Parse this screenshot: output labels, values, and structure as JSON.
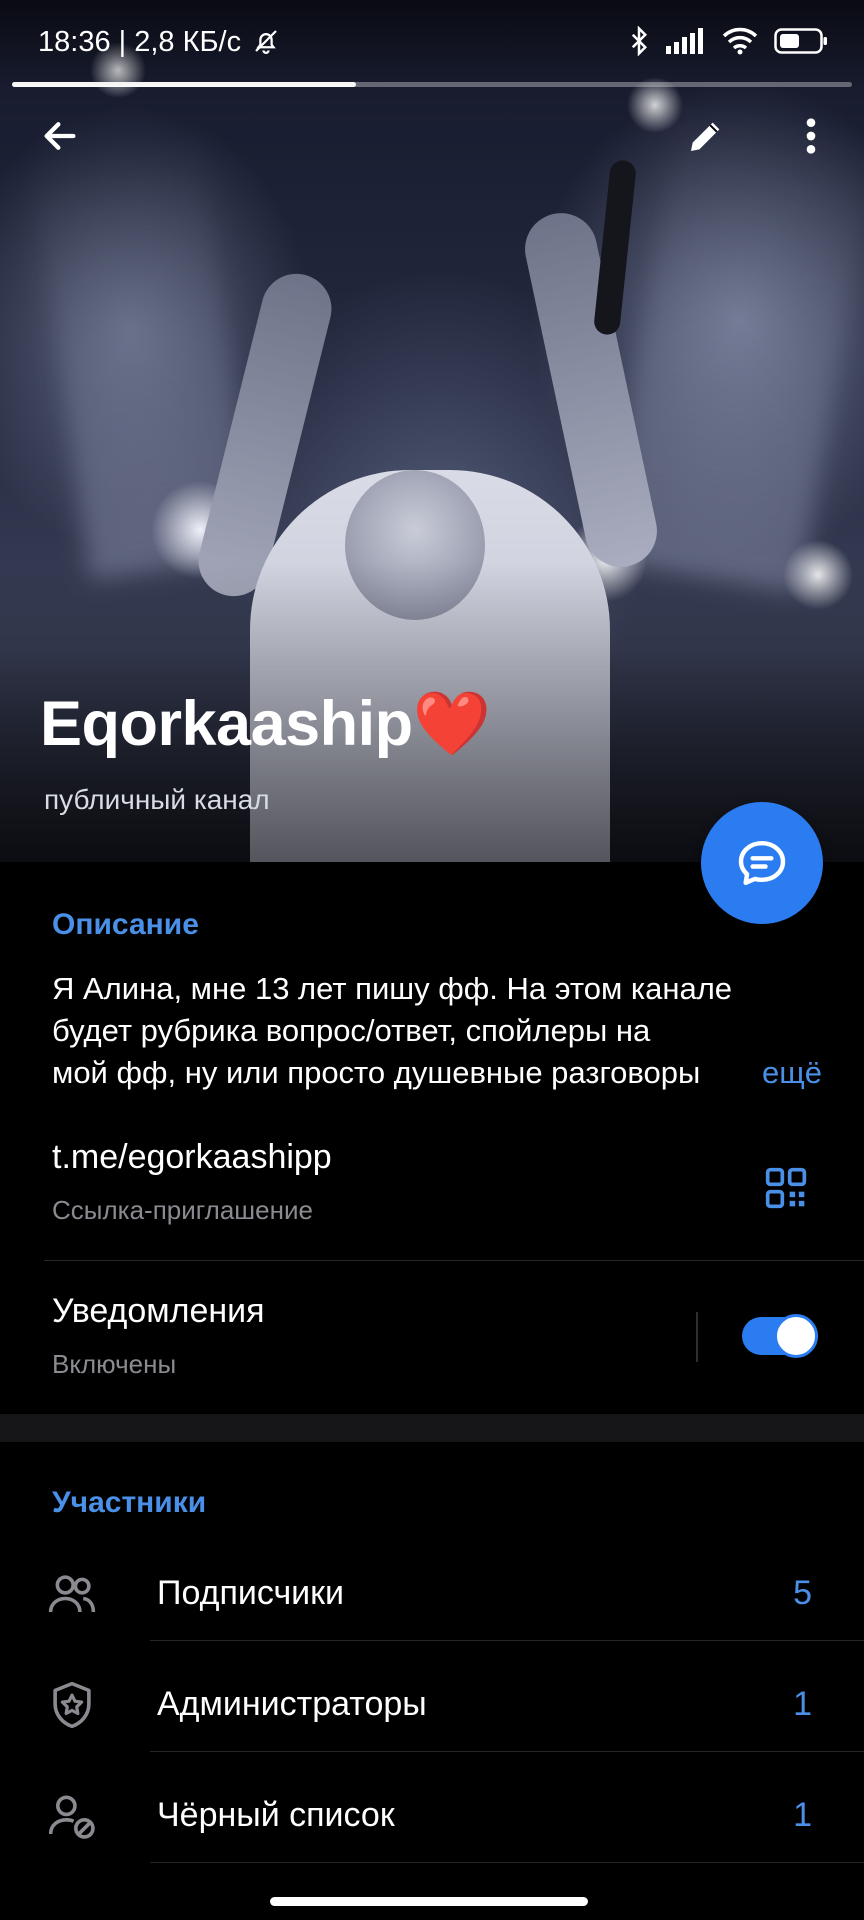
{
  "status_bar": {
    "time_speed": "18:36 | 2,8 КБ/с",
    "icons": [
      "bell-off-icon",
      "bluetooth-icon",
      "signal-icon",
      "wifi-icon",
      "battery-icon"
    ],
    "progress_fraction": 0.41
  },
  "toolbar": {
    "icons": [
      "back-arrow-icon",
      "pencil-icon",
      "more-vertical-icon"
    ]
  },
  "channel": {
    "title": "Eqorkaaship❤️",
    "subtitle": "публичный канал"
  },
  "fab": {
    "icon": "chat-bubble-icon"
  },
  "info": {
    "header": "Описание",
    "description_lines": [
      "Я Алина, мне 13 лет пишу фф. На этом канале",
      "будет рубрика вопрос/ответ, спойлеры на",
      "мой фф, ну или просто душевные разговоры"
    ],
    "more_label": "ещё",
    "link": "t.me/egorkaashipp",
    "link_sub": "Ссылка-приглашение",
    "link_icon": "qr-code-icon",
    "notifications_title": "Уведомления",
    "notifications_sub": "Включены",
    "notifications_on": true
  },
  "members": {
    "header": "Участники",
    "items": [
      {
        "label": "Подписчики",
        "count": "5",
        "icon": "users-icon"
      },
      {
        "label": "Администраторы",
        "count": "1",
        "icon": "shield-star-icon"
      },
      {
        "label": "Чёрный список",
        "count": "1",
        "icon": "user-blocked-icon"
      }
    ]
  },
  "colors": {
    "accent": "#4a90e8",
    "fab": "#2b7cf1",
    "background": "#000000",
    "secondary_text": "#8a8a91"
  }
}
